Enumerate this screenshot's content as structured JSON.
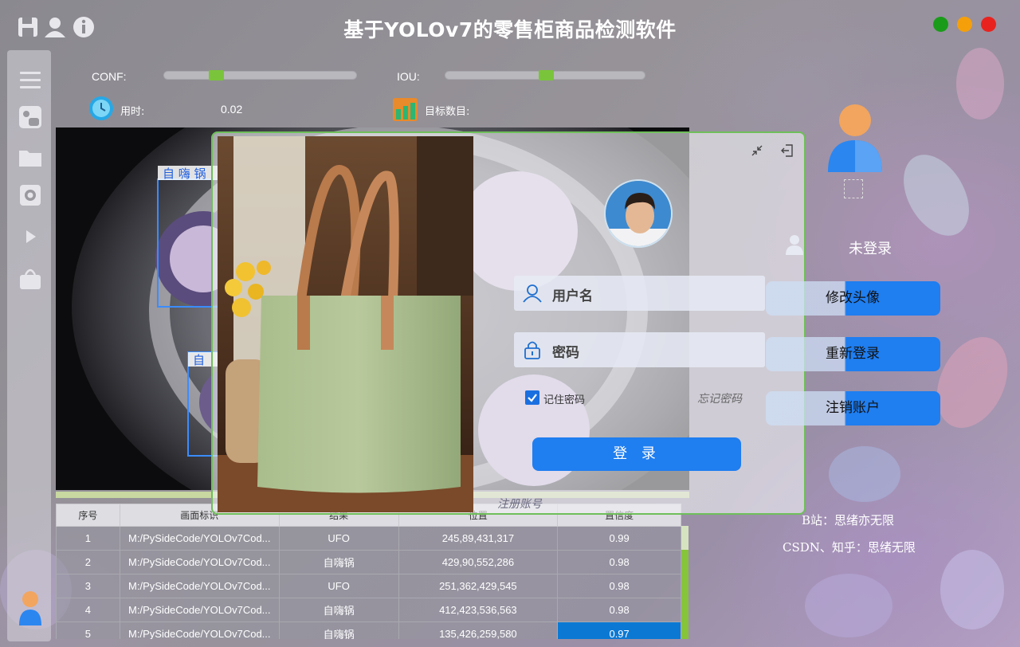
{
  "app": {
    "title": "基于YOLOv7的零售柜商品检测软件",
    "window_buttons": {
      "close_color": "#e8231f",
      "minimize_color": "#1a9c1a",
      "maximize_color": "#f5a00a"
    }
  },
  "titlebar_icons": [
    "save-icon",
    "user-icon",
    "info-icon"
  ],
  "sidebar": {
    "items": [
      "menu-icon",
      "image-icon",
      "folder-icon",
      "camera-icon",
      "play-icon",
      "bag-icon"
    ],
    "bottom_avatar": "user-avatar-icon"
  },
  "params": {
    "conf_label": "CONF:",
    "conf_value": 0.35,
    "iou_label": "IOU:",
    "iou_value": 0.5,
    "time_label": "用时:",
    "time_value": "0.02",
    "count_label": "目标数目:",
    "accent_color": "#7ac43b"
  },
  "table": {
    "headers": [
      "序号",
      "画面标识",
      "结果",
      "位置",
      "置信度"
    ],
    "rows": [
      {
        "no": "1",
        "path": "M:/PySideCode/YOLOv7Cod...",
        "result": "UFO",
        "pos": "245,89,431,317",
        "conf": "0.99"
      },
      {
        "no": "2",
        "path": "M:/PySideCode/YOLOv7Cod...",
        "result": "自嗨锅",
        "pos": "429,90,552,286",
        "conf": "0.98"
      },
      {
        "no": "3",
        "path": "M:/PySideCode/YOLOv7Cod...",
        "result": "UFO",
        "pos": "251,362,429,545",
        "conf": "0.98"
      },
      {
        "no": "4",
        "path": "M:/PySideCode/YOLOv7Cod...",
        "result": "自嗨锅",
        "pos": "412,423,536,563",
        "conf": "0.98"
      },
      {
        "no": "5",
        "path": "M:/PySideCode/YOLOv7Cod...",
        "result": "自嗨锅",
        "pos": "135,426,259,580",
        "conf": "0.97"
      }
    ]
  },
  "login": {
    "username_placeholder": "用户名",
    "password_placeholder": "密码",
    "remember_label": "记住密码",
    "remember_checked": true,
    "forgot_label": "忘记密码",
    "login_button": "登 录",
    "register_label": "注册账号",
    "icons": [
      "minimize-icon",
      "exit-icon",
      "user-icon",
      "lock-icon"
    ]
  },
  "user_panel": {
    "status": "未登录",
    "buttons": [
      "修改头像",
      "重新登录",
      "注销账户"
    ],
    "credit_1": "B站：思绪亦无限",
    "credit_2": "CSDN、知乎：思绪无限"
  }
}
